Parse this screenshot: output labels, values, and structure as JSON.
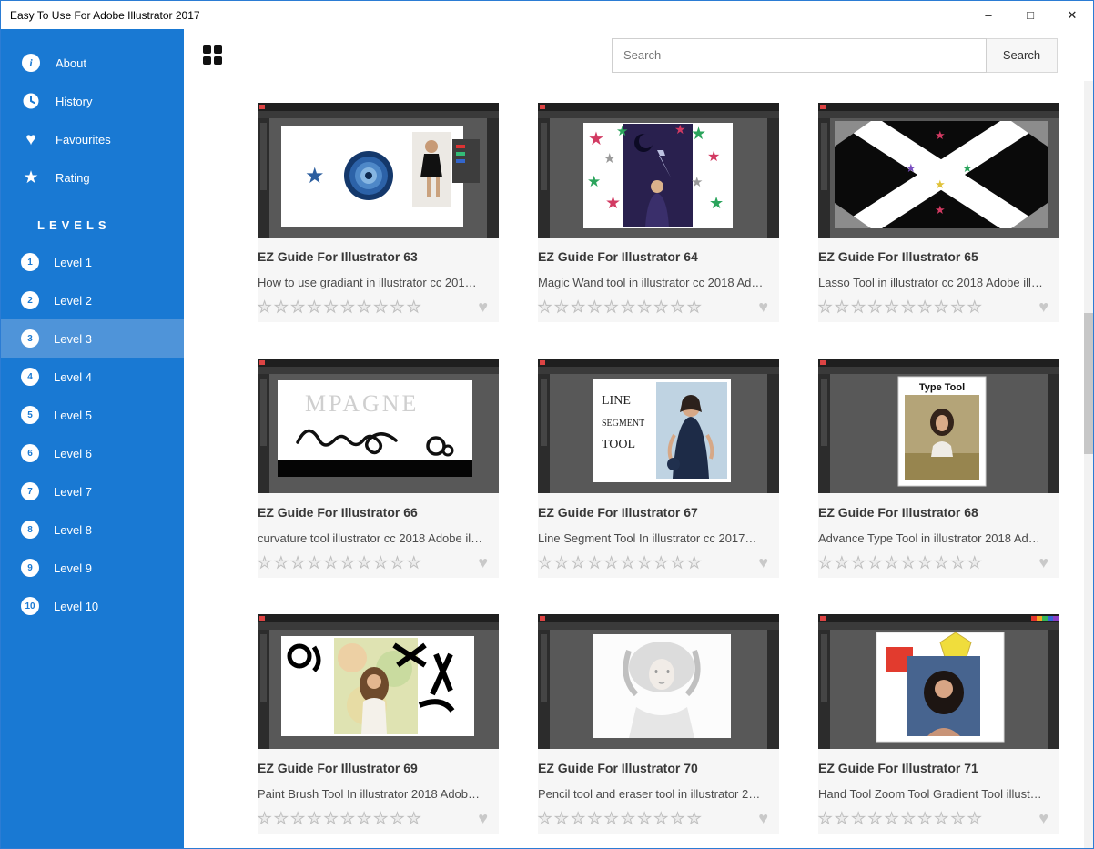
{
  "window": {
    "title": "Easy To Use For Adobe Illustrator 2017",
    "controls": {
      "minimize": "–",
      "maximize": "□",
      "close": "✕"
    }
  },
  "icons": {
    "info": "i",
    "heart": "♥",
    "star": "★"
  },
  "sidebar": {
    "items": [
      {
        "label": "About"
      },
      {
        "label": "History"
      },
      {
        "label": "Favourites"
      },
      {
        "label": "Rating"
      }
    ],
    "levels_header": "LEVELS",
    "levels": [
      {
        "num": "1",
        "label": "Level 1",
        "active": false
      },
      {
        "num": "2",
        "label": "Level 2",
        "active": false
      },
      {
        "num": "3",
        "label": "Level 3",
        "active": true
      },
      {
        "num": "4",
        "label": "Level 4",
        "active": false
      },
      {
        "num": "5",
        "label": "Level 5",
        "active": false
      },
      {
        "num": "6",
        "label": "Level 6",
        "active": false
      },
      {
        "num": "7",
        "label": "Level 7",
        "active": false
      },
      {
        "num": "8",
        "label": "Level 8",
        "active": false
      },
      {
        "num": "9",
        "label": "Level 9",
        "active": false
      },
      {
        "num": "10",
        "label": "Level 10",
        "active": false
      }
    ]
  },
  "topbar": {
    "search_placeholder": "Search",
    "search_button_label": "Search"
  },
  "rating": {
    "star_count": 10
  },
  "colors": {
    "accent": "#1979d3",
    "active_item": "#4f94d9"
  },
  "cards": [
    {
      "title": "EZ Guide For Illustrator 63",
      "description": "How to use gradiant in illustrator cc 201…",
      "thumb": "gradient-circles"
    },
    {
      "title": "EZ Guide For Illustrator 64",
      "description": "Magic Wand tool in illustrator cc 2018 Ad…",
      "thumb": "star-poster"
    },
    {
      "title": "EZ Guide For Illustrator 65",
      "description": "Lasso Tool in illustrator cc 2018 Adobe ill…",
      "thumb": "black-white-pattern"
    },
    {
      "title": "EZ Guide For Illustrator 66",
      "description": "curvature tool illustrator cc 2018 Adobe il…",
      "thumb": "squiggle-lettering"
    },
    {
      "title": "EZ Guide For Illustrator 67",
      "description": "Line Segment Tool In illustrator cc 2017…",
      "thumb": "line-segment-photo"
    },
    {
      "title": "EZ Guide For Illustrator 68",
      "description": "Advance Type Tool in illustrator 2018 Ad…",
      "thumb": "type-tool-photo"
    },
    {
      "title": "EZ Guide For Illustrator 69",
      "description": "Paint Brush Tool In illustrator 2018 Adob…",
      "thumb": "paint-brush-portrait"
    },
    {
      "title": "EZ Guide For Illustrator 70",
      "description": "Pencil tool and eraser tool in illustrator 2…",
      "thumb": "pencil-sketch"
    },
    {
      "title": "EZ Guide For Illustrator 71",
      "description": "Hand Tool Zoom Tool Gradient Tool illust…",
      "thumb": "shapes-photo"
    }
  ]
}
